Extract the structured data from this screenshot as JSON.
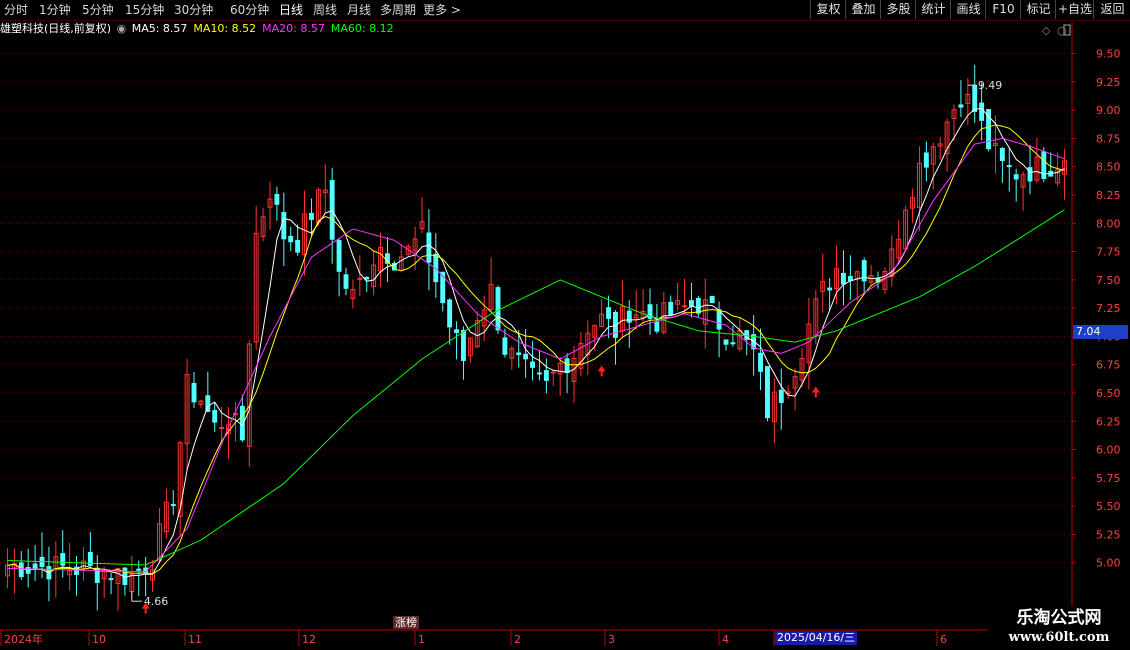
{
  "toolbar": {
    "periods": [
      {
        "label": "分时",
        "active": false
      },
      {
        "label": "1分钟",
        "active": false
      },
      {
        "label": "5分钟",
        "active": false
      },
      {
        "label": "15分钟",
        "active": false
      },
      {
        "label": "30分钟",
        "active": false
      },
      {
        "label": "60分钟",
        "active": false
      },
      {
        "label": "日线",
        "active": true
      },
      {
        "label": "周线",
        "active": false
      },
      {
        "label": "月线",
        "active": false
      },
      {
        "label": "多周期",
        "active": false
      },
      {
        "label": "更多 >",
        "active": false
      }
    ],
    "buttons": [
      "复权",
      "叠加",
      "多股",
      "统计",
      "画线",
      "F10",
      "标记",
      "+自选",
      "返回"
    ]
  },
  "info": {
    "title": "雄塑科技(日线,前复权)",
    "ma_items": [
      {
        "label": "MA5: 8.57",
        "color": "#ffffff"
      },
      {
        "label": "MA10: 8.52",
        "color": "#ffff00"
      },
      {
        "label": "MA20: 8.57",
        "color": "#ff33ff"
      },
      {
        "label": "MA60: 8.12",
        "color": "#00ff00"
      }
    ]
  },
  "chart_data": {
    "type": "candlestick",
    "ylim": [
      4.6,
      9.62
    ],
    "yticks": [
      5.0,
      5.25,
      5.5,
      5.75,
      6.0,
      6.25,
      6.5,
      6.75,
      7.0,
      7.25,
      7.5,
      7.75,
      8.0,
      8.25,
      8.5,
      8.75,
      9.0,
      9.25,
      9.5
    ],
    "x_labels": [
      "2024年",
      "10",
      "11",
      "12",
      "1",
      "2",
      "3",
      "4",
      "2025/04/16/三",
      "6"
    ],
    "current_price": "7.04",
    "high_label": "9.49",
    "low_label": "4.66",
    "zt_label": "涨榜",
    "trend_points": [
      [
        0,
        4.98
      ],
      [
        10,
        4.95
      ],
      [
        15,
        4.92
      ],
      [
        18,
        4.88
      ],
      [
        21,
        5.05
      ],
      [
        24,
        5.6
      ],
      [
        26,
        6.55
      ],
      [
        28,
        6.45
      ],
      [
        30,
        6.2
      ],
      [
        32,
        6.3
      ],
      [
        34,
        6.1
      ],
      [
        36,
        7.9
      ],
      [
        38,
        8.3
      ],
      [
        40,
        7.9
      ],
      [
        42,
        7.85
      ],
      [
        44,
        8.1
      ],
      [
        46,
        8.3
      ],
      [
        48,
        7.55
      ],
      [
        50,
        7.35
      ],
      [
        52,
        7.6
      ],
      [
        54,
        7.8
      ],
      [
        56,
        7.7
      ],
      [
        58,
        7.75
      ],
      [
        60,
        7.9
      ],
      [
        62,
        7.5
      ],
      [
        64,
        7.1
      ],
      [
        66,
        6.8
      ],
      [
        68,
        7.2
      ],
      [
        70,
        7.4
      ],
      [
        72,
        6.9
      ],
      [
        74,
        6.75
      ],
      [
        76,
        6.62
      ],
      [
        78,
        6.55
      ],
      [
        80,
        6.75
      ],
      [
        82,
        6.85
      ],
      [
        84,
        7.1
      ],
      [
        86,
        7.15
      ],
      [
        88,
        7.05
      ],
      [
        90,
        7.25
      ],
      [
        92,
        7.2
      ],
      [
        94,
        7.15
      ],
      [
        96,
        7.2
      ],
      [
        98,
        7.25
      ],
      [
        100,
        7.3
      ],
      [
        102,
        7.2
      ],
      [
        104,
        7.05
      ],
      [
        106,
        7.0
      ],
      [
        108,
        6.85
      ],
      [
        110,
        6.35
      ],
      [
        112,
        6.5
      ],
      [
        114,
        6.75
      ],
      [
        116,
        7.1
      ],
      [
        118,
        7.4
      ],
      [
        120,
        7.6
      ],
      [
        122,
        7.55
      ],
      [
        124,
        7.6
      ],
      [
        126,
        7.55
      ],
      [
        128,
        7.7
      ],
      [
        130,
        8.2
      ],
      [
        132,
        8.5
      ],
      [
        134,
        8.7
      ],
      [
        136,
        8.9
      ],
      [
        138,
        9.15
      ],
      [
        140,
        9.0
      ],
      [
        142,
        8.7
      ],
      [
        144,
        8.5
      ],
      [
        146,
        8.45
      ],
      [
        148,
        8.48
      ],
      [
        150,
        8.5
      ],
      [
        152,
        8.55
      ],
      [
        153,
        8.6
      ]
    ],
    "ma60_points": [
      [
        0,
        5.02
      ],
      [
        20,
        4.98
      ],
      [
        28,
        5.2
      ],
      [
        40,
        5.7
      ],
      [
        50,
        6.3
      ],
      [
        60,
        6.8
      ],
      [
        70,
        7.2
      ],
      [
        80,
        7.5
      ],
      [
        86,
        7.35
      ],
      [
        92,
        7.2
      ],
      [
        100,
        7.05
      ],
      [
        108,
        7.0
      ],
      [
        114,
        6.95
      ],
      [
        120,
        7.05
      ],
      [
        126,
        7.2
      ],
      [
        132,
        7.35
      ],
      [
        140,
        7.62
      ],
      [
        146,
        7.85
      ],
      [
        153,
        8.12
      ]
    ],
    "ma20_points": [
      [
        0,
        4.95
      ],
      [
        20,
        4.92
      ],
      [
        26,
        5.3
      ],
      [
        32,
        6.2
      ],
      [
        38,
        7.0
      ],
      [
        44,
        7.7
      ],
      [
        50,
        7.95
      ],
      [
        56,
        7.85
      ],
      [
        62,
        7.6
      ],
      [
        68,
        7.2
      ],
      [
        74,
        6.95
      ],
      [
        80,
        6.8
      ],
      [
        86,
        7.0
      ],
      [
        92,
        7.1
      ],
      [
        98,
        7.2
      ],
      [
        104,
        7.1
      ],
      [
        108,
        6.9
      ],
      [
        112,
        6.85
      ],
      [
        116,
        6.95
      ],
      [
        122,
        7.3
      ],
      [
        128,
        7.55
      ],
      [
        134,
        8.2
      ],
      [
        140,
        8.7
      ],
      [
        144,
        8.75
      ],
      [
        148,
        8.68
      ],
      [
        153,
        8.57
      ]
    ],
    "signals": [
      20,
      86,
      117
    ],
    "accent_up": "#ff3232",
    "accent_down": "#54ffff",
    "grid_color": "#7a0000"
  },
  "watermark": {
    "title": "乐淘公式网",
    "url": "www.60lt.com"
  }
}
